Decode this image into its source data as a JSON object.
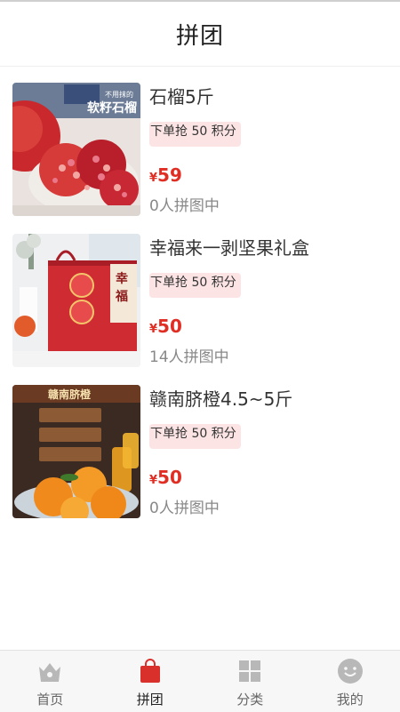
{
  "header": {
    "title": "拼团"
  },
  "products": [
    {
      "name": "石榴5斤",
      "badge": "下单抢 50 积分",
      "currency": "¥",
      "price": "59",
      "group_status": "0人拼图中",
      "image": {
        "kind": "pomegranate",
        "caption_line1": "不用抹的",
        "caption_line2": "软籽石榴"
      }
    },
    {
      "name": "幸福来一剥坚果礼盒",
      "badge": "下单抢 50 积分",
      "currency": "¥",
      "price": "50",
      "group_status": "14人拼图中",
      "image": {
        "kind": "gift-box",
        "caption_line1": "幸",
        "caption_line2": "福"
      }
    },
    {
      "name": "赣南脐橙4.5~5斤",
      "badge": "下单抢 50 积分",
      "currency": "¥",
      "price": "50",
      "group_status": "0人拼图中",
      "image": {
        "kind": "navel-orange",
        "caption_line1": "赣南脐橙",
        "caption_line2": ""
      }
    }
  ],
  "tabbar": {
    "active": "拼团",
    "tabs": [
      {
        "label": "首页",
        "icon": "home-crown-icon"
      },
      {
        "label": "拼团",
        "icon": "shopping-bag-icon"
      },
      {
        "label": "分类",
        "icon": "category-grid-icon"
      },
      {
        "label": "我的",
        "icon": "profile-smile-icon"
      }
    ]
  },
  "colors": {
    "accent": "#e02e24",
    "badge_bg": "#fde4e4",
    "tab_active": "#d9302c",
    "tab_inactive": "#b8b8b8"
  }
}
